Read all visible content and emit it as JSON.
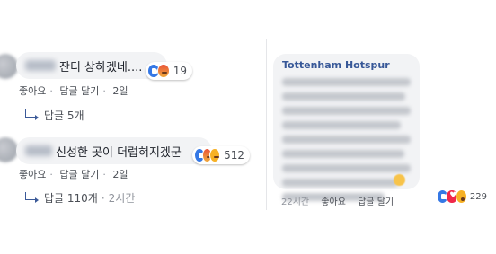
{
  "comments": [
    {
      "text": "잔디 상하겠네....",
      "reactions": [
        "like",
        "angry"
      ],
      "reaction_count": "19",
      "actions": {
        "like": "좋아요",
        "reply": "답글 달기",
        "time": "2일"
      },
      "replies": "답글 5개",
      "replies_time": ""
    },
    {
      "text": "신성한 곳이 더럽혀지겠군",
      "reactions": [
        "like",
        "angry",
        "haha"
      ],
      "reaction_count": "512",
      "actions": {
        "like": "좋아요",
        "reply": "답글 달기",
        "time": "2일"
      },
      "replies": "답글 110개",
      "replies_time": "2시간"
    }
  ],
  "page_comment": {
    "author": "Tottenham Hotspur",
    "time": "22시간",
    "like": "좋아요",
    "reply": "답글 달기",
    "reactions": [
      "like",
      "love",
      "wow"
    ],
    "reaction_count": "229"
  },
  "colors": {
    "bubble": "#f2f3f5",
    "link": "#385898",
    "like": "#3578e5",
    "love": "#f0284a",
    "angry": "#e9543a",
    "haha": "#f7b125"
  }
}
